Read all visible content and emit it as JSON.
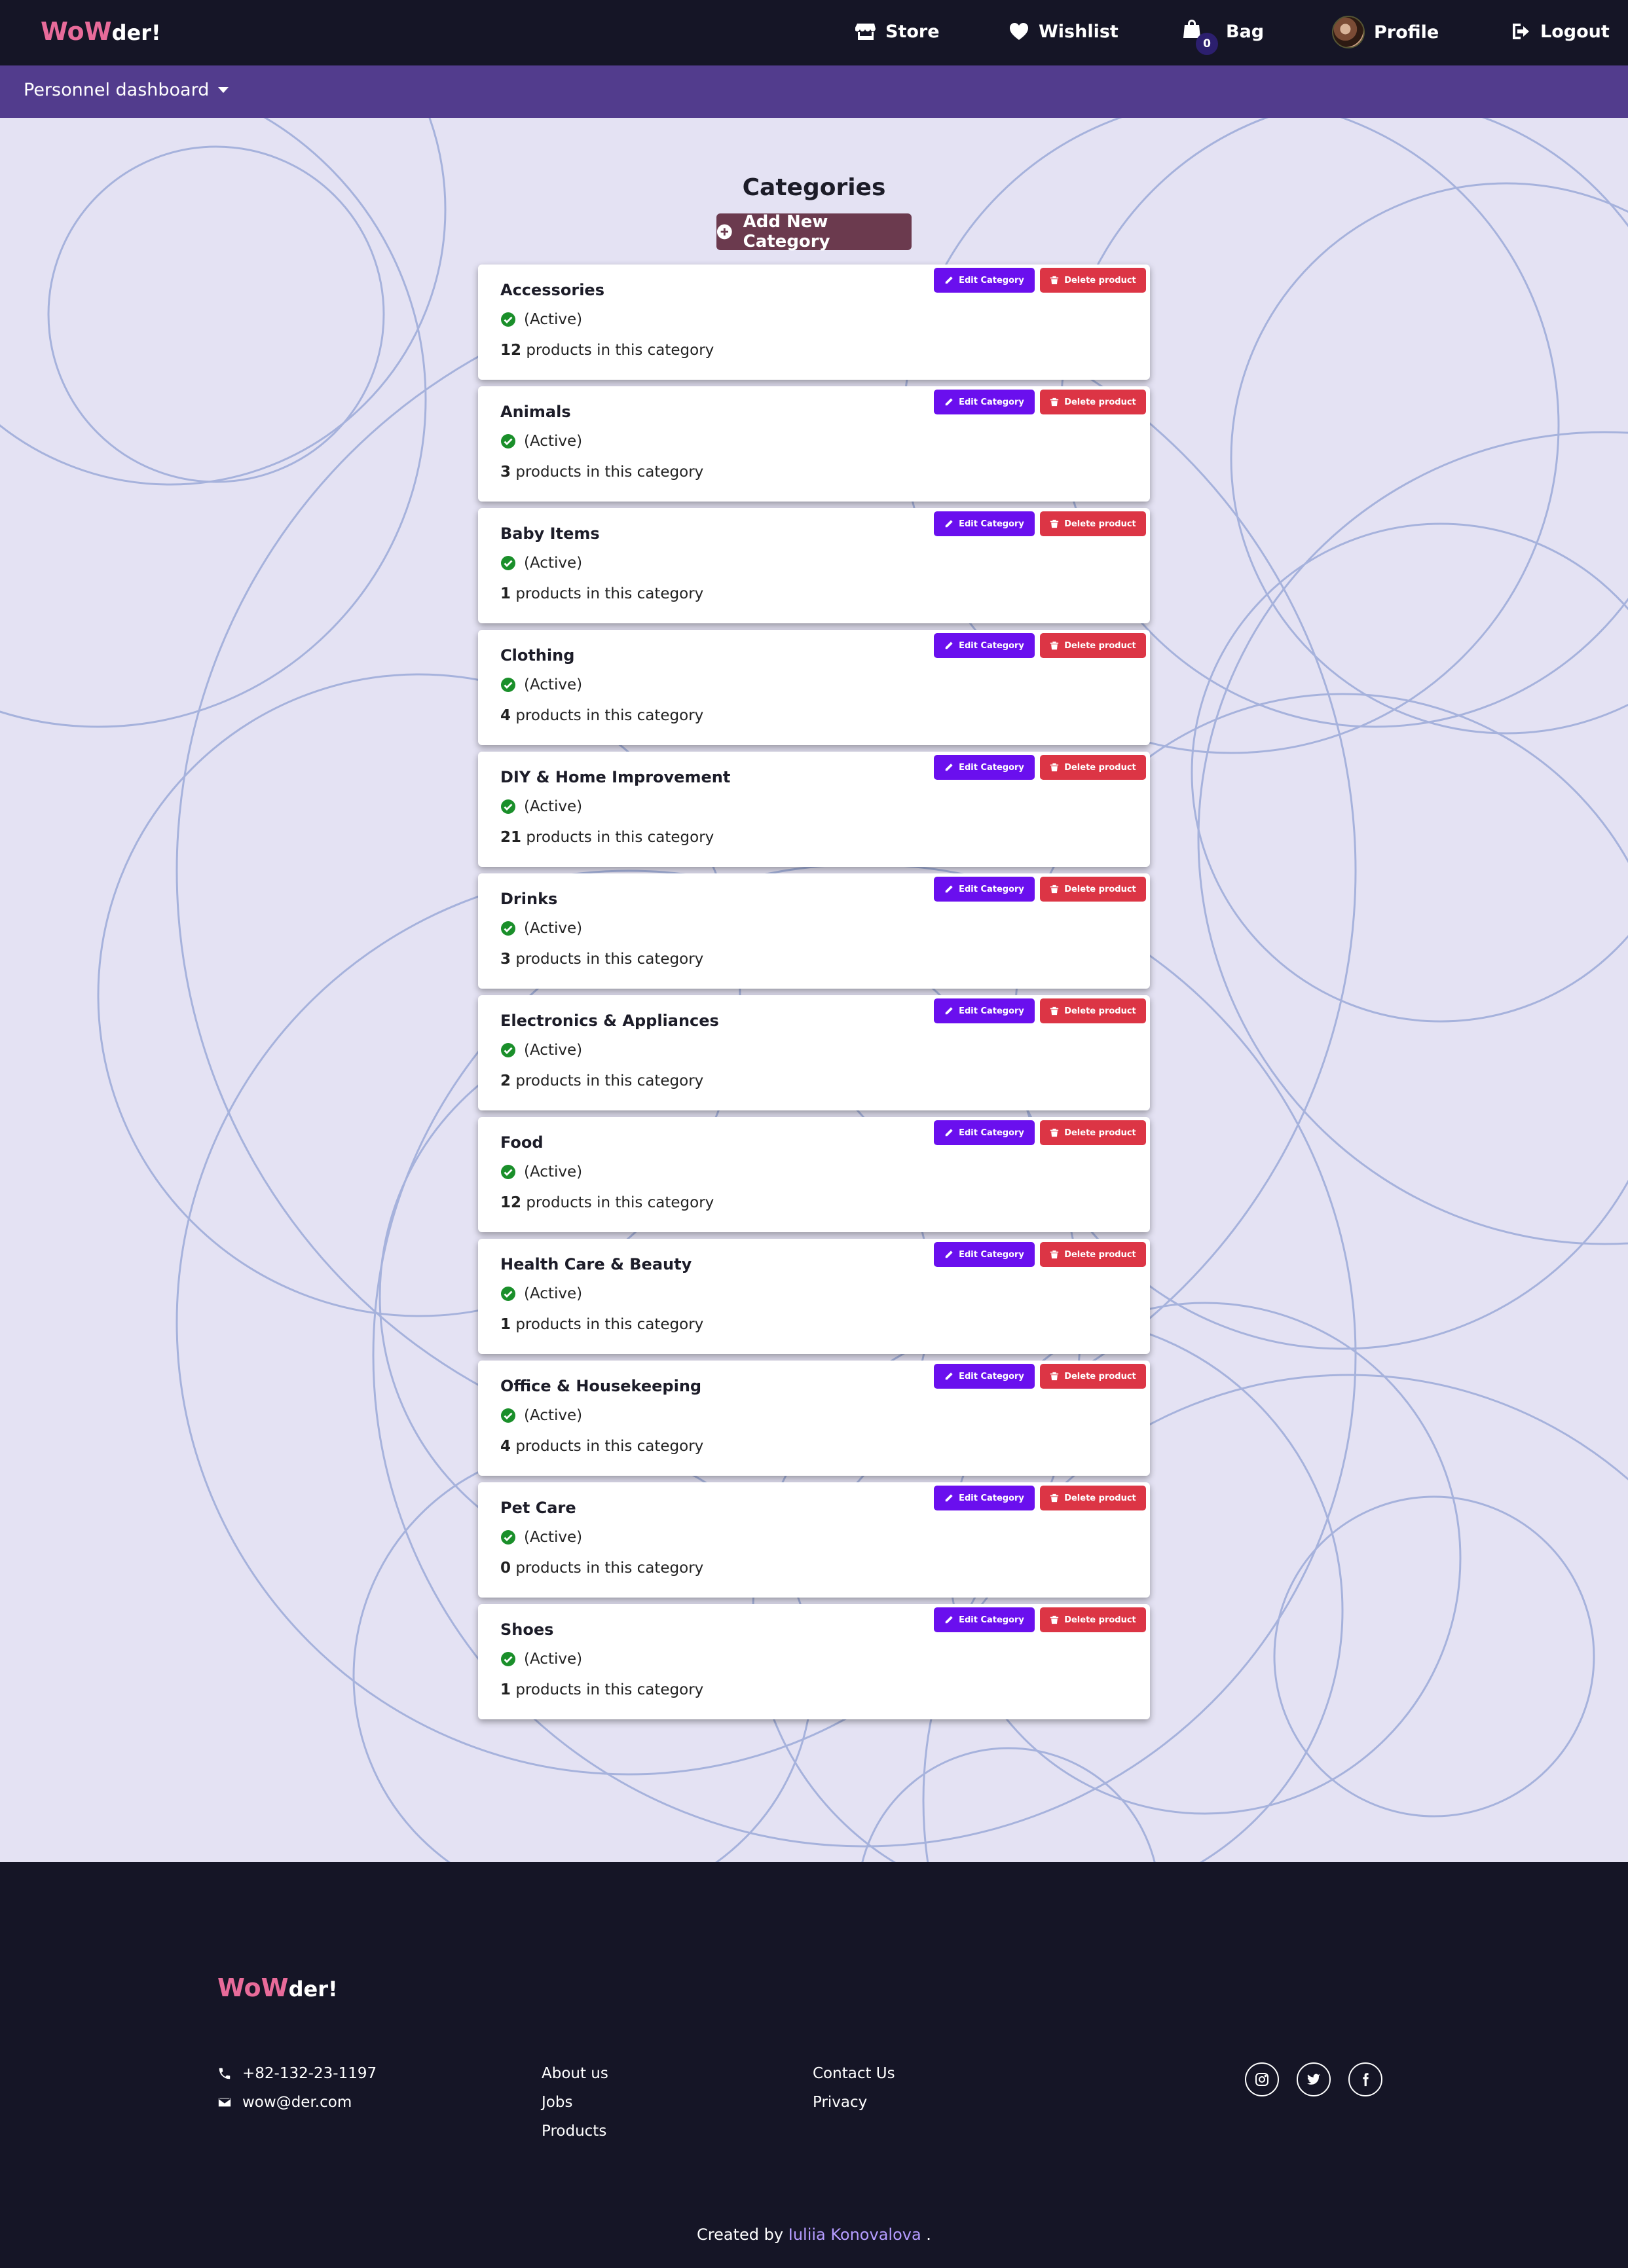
{
  "brand": {
    "part1": "WoW",
    "part2": "der!"
  },
  "nav": {
    "store": "Store",
    "wishlist": "Wishlist",
    "bag": "Bag",
    "bag_count": "0",
    "profile": "Profile",
    "logout": "Logout"
  },
  "subnav": {
    "dashboard": "Personnel dashboard"
  },
  "page": {
    "title": "Categories",
    "add_button": "Add New Category"
  },
  "card_labels": {
    "edit": "Edit Category",
    "delete": "Delete product",
    "status": "(Active)",
    "count_suffix": " products in this category"
  },
  "categories": [
    {
      "name": "Accessories",
      "count": "12"
    },
    {
      "name": "Animals",
      "count": "3"
    },
    {
      "name": "Baby Items",
      "count": "1"
    },
    {
      "name": "Clothing",
      "count": "4"
    },
    {
      "name": "DIY & Home Improvement",
      "count": "21"
    },
    {
      "name": "Drinks",
      "count": "3"
    },
    {
      "name": "Electronics & Appliances",
      "count": "2"
    },
    {
      "name": "Food",
      "count": "12"
    },
    {
      "name": "Health Care & Beauty",
      "count": "1"
    },
    {
      "name": "Office & Housekeeping",
      "count": "4"
    },
    {
      "name": "Pet Care",
      "count": "0"
    },
    {
      "name": "Shoes",
      "count": "1"
    }
  ],
  "footer": {
    "phone": "+82-132-23-1197",
    "email": "wow@der.com",
    "links_col1": [
      "About us",
      "Jobs",
      "Products"
    ],
    "links_col2": [
      "Contact Us",
      "Privacy"
    ],
    "credit_prefix": "Created by",
    "credit_name": "Iuliia Konovalova",
    "credit_suffix": "."
  },
  "colors": {
    "nav_bg": "#151526",
    "subnav_bg": "#523c8d",
    "page_bg": "#e4e2f3",
    "brand_pink": "#e86b9a",
    "edit_purple": "#6a0fee",
    "delete_red": "#dc3545",
    "active_green": "#1a8f2a",
    "add_btn": "#6b3a4e"
  },
  "icons": {
    "store": "store-icon",
    "wishlist": "heart-icon",
    "bag": "shopping-bag-icon",
    "logout": "logout-icon",
    "add": "plus-circle-icon",
    "edit": "pencil-icon",
    "delete": "trash-icon",
    "status": "check-circle-icon",
    "phone": "phone-icon",
    "email": "envelope-icon",
    "instagram": "instagram-icon",
    "twitter": "twitter-icon",
    "facebook": "facebook-icon"
  }
}
